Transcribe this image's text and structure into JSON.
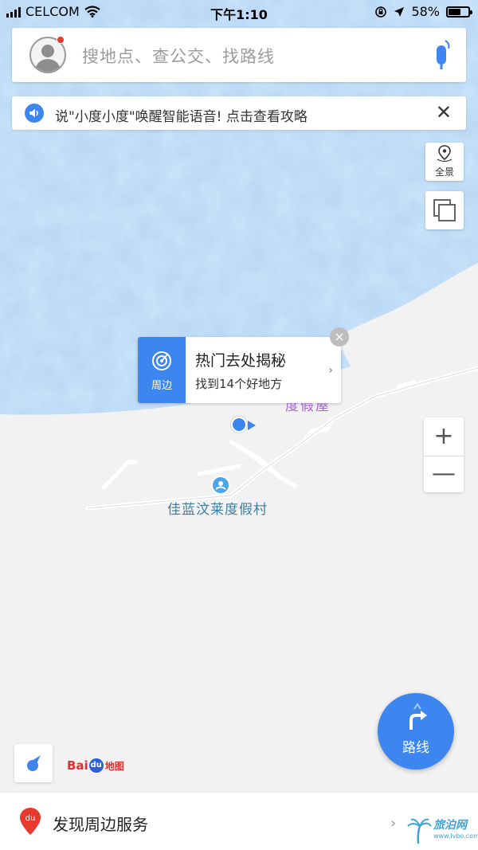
{
  "status_bar": {
    "carrier": "CELCOM",
    "time": "下午1:10",
    "battery_percent": "58%",
    "battery_level": 0.58
  },
  "search": {
    "placeholder": "搜地点、查公交、找路线"
  },
  "voice_banner": {
    "text": "说\"小度小度\"唤醒智能语音! 点击查看攻略",
    "close": "✕"
  },
  "map_controls": {
    "panorama_label": "全景",
    "zoom_in": "+",
    "zoom_out": "—"
  },
  "popup": {
    "side_label": "周边",
    "title": "热门去处揭秘",
    "subtitle": "找到14个好地方",
    "arrow": "›",
    "close": "×"
  },
  "map_labels": {
    "partial_poi": "度假屋",
    "resort_poi": "佳蓝汶莱度假村"
  },
  "route_button": {
    "label": "路线"
  },
  "logo": {
    "bai": "Bai",
    "du": "du",
    "map": "地图"
  },
  "bottom_bar": {
    "label": "发现周边服务",
    "pin_text": "du"
  },
  "watermark": {
    "text": "旅泊网",
    "sub": "www.lvbo.com",
    "arrow": "›"
  },
  "colors": {
    "accent_blue": "#3d86ef",
    "water": "#bcd9f6",
    "land": "#f2f2f2",
    "notification_red": "#e8392c"
  }
}
